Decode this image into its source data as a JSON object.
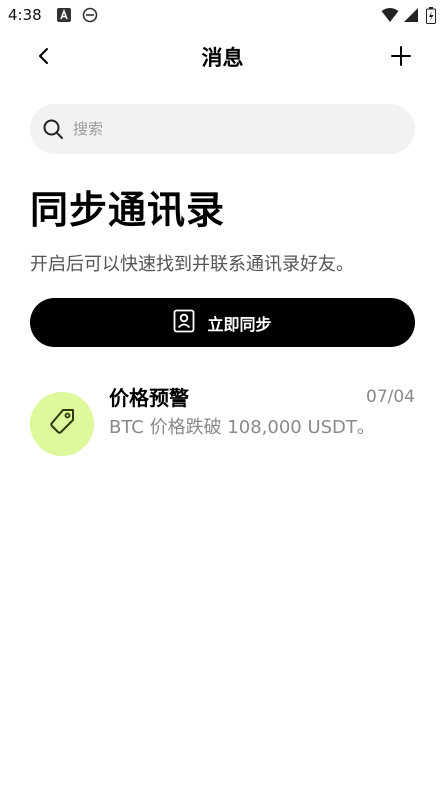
{
  "status_bar": {
    "time": "4:38",
    "icons": [
      "a-icon",
      "e-icon",
      "wifi-icon",
      "signal-icon",
      "battery-icon"
    ]
  },
  "nav": {
    "title": "消息",
    "back_icon": "chevron-left-icon",
    "add_icon": "plus-icon"
  },
  "search": {
    "placeholder": "搜索",
    "icon": "search-icon"
  },
  "sync": {
    "title": "同步通讯录",
    "description": "开启后可以快速找到并联系通讯录好友。",
    "button_label": "立即同步",
    "button_icon": "contact-card-icon"
  },
  "messages": [
    {
      "title": "价格预警",
      "date": "07/04",
      "preview": "BTC 价格跌破 108,000 USDT。",
      "icon": "price-tag-icon",
      "avatar_color": "#ddf99b"
    }
  ],
  "colors": {
    "accent_button": "#000000",
    "search_bg": "#f2f2f2",
    "avatar_bg": "#ddf99b"
  }
}
